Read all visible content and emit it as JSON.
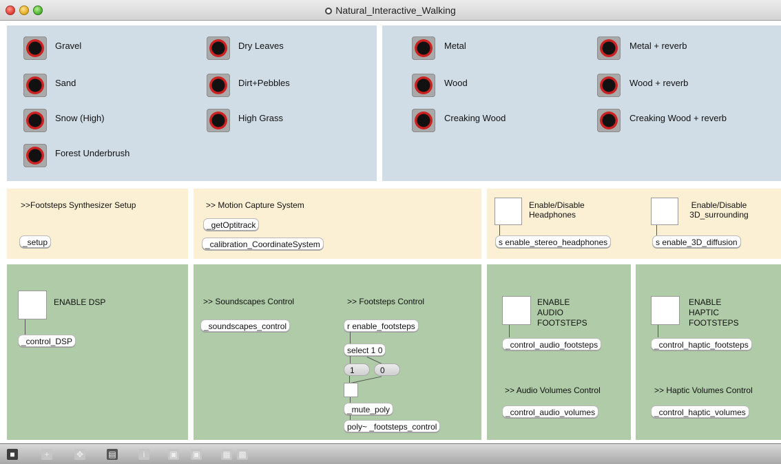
{
  "window": {
    "title": "Natural_Interactive_Walking"
  },
  "sounds": {
    "gravel": "Gravel",
    "sand": "Sand",
    "snow": "Snow (High)",
    "forest": "Forest Underbrush",
    "dry_leaves": "Dry Leaves",
    "dirt": "Dirt+Pebbles",
    "grass": "High Grass",
    "metal": "Metal",
    "wood": "Wood",
    "creaking": "Creaking Wood",
    "metal_rev": "Metal + reverb",
    "wood_rev": "Wood + reverb",
    "creaking_rev": "Creaking Wood + reverb"
  },
  "setup": {
    "heading": ">>Footsteps Synthesizer Setup",
    "obj": "_setup"
  },
  "mocap": {
    "heading": ">> Motion Capture System",
    "obj1": "_getOptitrack",
    "obj2": "_calibration_CoordinateSystem"
  },
  "headphones": {
    "label": "Enable/Disable\nHeadphones",
    "obj": "s enable_stereo_headphones"
  },
  "surround": {
    "label": "Enable/Disable\n3D_surrounding",
    "obj": "s enable_3D_diffusion"
  },
  "dsp": {
    "label": "ENABLE DSP",
    "obj": "_control_DSP"
  },
  "soundscapes": {
    "heading": ">> Soundscapes Control",
    "obj": "_soundscapes_control"
  },
  "footsteps": {
    "heading": ">> Footsteps Control",
    "recv": "r enable_footsteps",
    "select": "select 1 0",
    "msg1": "1",
    "msg0": "0",
    "mute": "_mute_poly",
    "poly": "poly~ _footsteps_control"
  },
  "audio": {
    "label": "ENABLE\nAUDIO\nFOOTSTEPS",
    "obj": "_control_audio_footsteps",
    "vol_heading": ">> Audio Volumes Control",
    "vol_obj": "_control_audio_volumes"
  },
  "haptic": {
    "label": "ENABLE\nHAPTIC\nFOOTSTEPS",
    "obj": "_control_haptic_footsteps",
    "vol_heading": ">> Haptic Volumes Control",
    "vol_obj": "_control_haptic_volumes"
  },
  "toolbar": {
    "icons": [
      "lock-icon",
      "add-icon",
      "move-icon",
      "presentation-icon",
      "info-icon",
      "window-icon",
      "window-stack-icon",
      "grid-icon",
      "snap-icon"
    ]
  }
}
